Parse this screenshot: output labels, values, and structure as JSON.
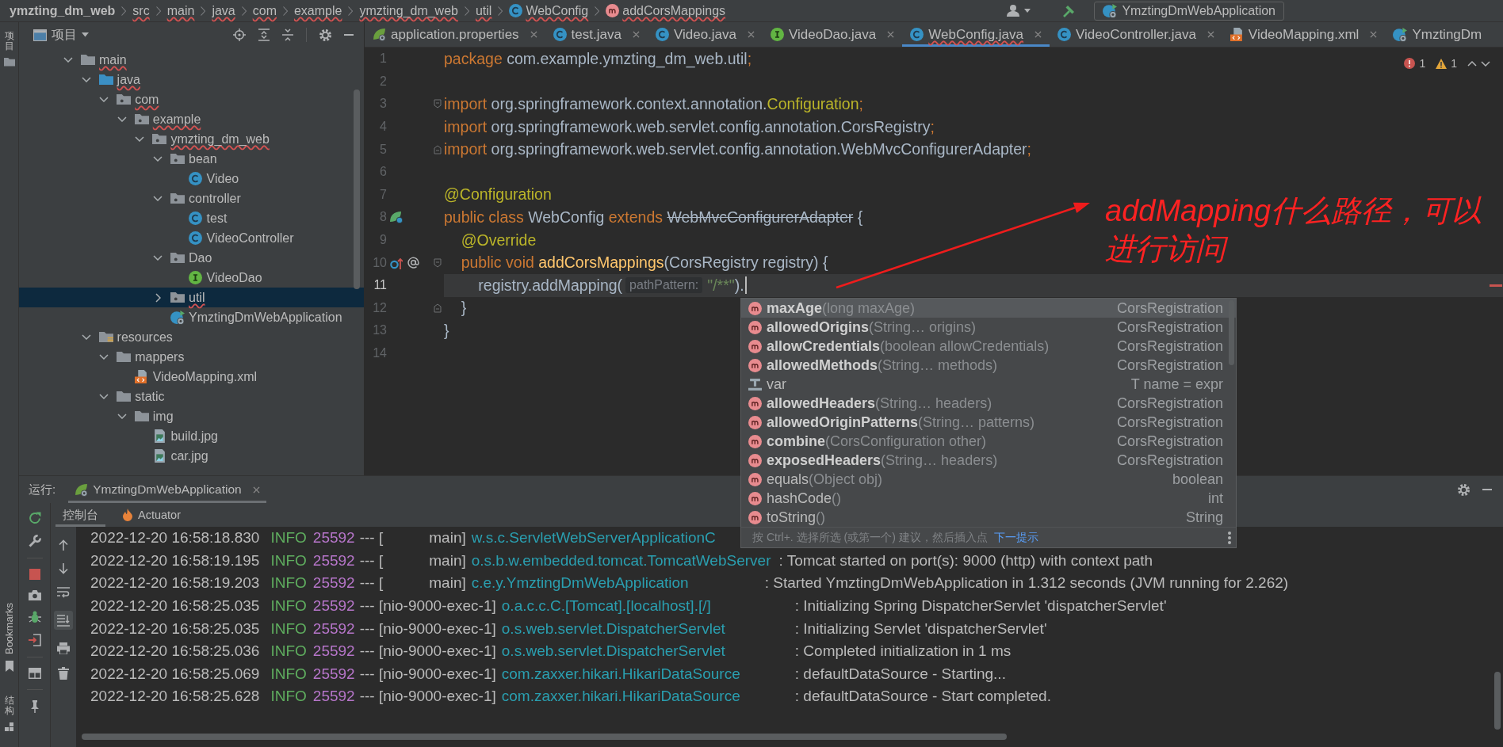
{
  "breadcrumbs": [
    {
      "text": "ymzting_dm_web",
      "kind": "project",
      "misspelled": false
    },
    {
      "text": "src",
      "kind": "folder",
      "misspelled": true
    },
    {
      "text": "main",
      "kind": "folder",
      "misspelled": true
    },
    {
      "text": "java",
      "kind": "folder",
      "misspelled": true
    },
    {
      "text": "com",
      "kind": "folder",
      "misspelled": true
    },
    {
      "text": "example",
      "kind": "folder",
      "misspelled": true
    },
    {
      "text": "ymzting_dm_web",
      "kind": "folder",
      "misspelled": true
    },
    {
      "text": "util",
      "kind": "folder",
      "misspelled": true
    },
    {
      "text": "WebConfig",
      "kind": "class",
      "misspelled": true
    },
    {
      "text": "addCorsMappings",
      "kind": "method",
      "misspelled": true
    }
  ],
  "run_config": {
    "label": "YmztingDmWebApplication"
  },
  "tool_strip": {
    "top": [
      {
        "label": "项目",
        "kind": "project"
      }
    ],
    "bottom": [
      {
        "label": "Bookmarks",
        "kind": "bookmarks"
      },
      {
        "label": "结构",
        "kind": "structure"
      }
    ]
  },
  "project_panel": {
    "title": "项目",
    "tree": [
      {
        "label": "main",
        "kind": "folder",
        "expanded": true,
        "selected": false,
        "misspelled": true,
        "children": [
          {
            "label": "java",
            "kind": "source-root",
            "expanded": true,
            "selected": false,
            "misspelled": true,
            "children": [
              {
                "label": "com",
                "kind": "package",
                "expanded": true,
                "selected": false,
                "misspelled": true,
                "children": [
                  {
                    "label": "example",
                    "kind": "package",
                    "expanded": true,
                    "selected": false,
                    "misspelled": true,
                    "children": [
                      {
                        "label": "ymzting_dm_web",
                        "kind": "package",
                        "expanded": true,
                        "selected": false,
                        "misspelled": true,
                        "children": [
                          {
                            "label": "bean",
                            "kind": "package",
                            "expanded": true,
                            "selected": false,
                            "misspelled": false,
                            "children": [
                              {
                                "label": "Video",
                                "kind": "class",
                                "selected": false,
                                "misspelled": false
                              }
                            ]
                          },
                          {
                            "label": "controller",
                            "kind": "package",
                            "expanded": true,
                            "selected": false,
                            "misspelled": false,
                            "children": [
                              {
                                "label": "test",
                                "kind": "class",
                                "selected": false,
                                "misspelled": false
                              },
                              {
                                "label": "VideoController",
                                "kind": "class",
                                "selected": false,
                                "misspelled": false
                              }
                            ]
                          },
                          {
                            "label": "Dao",
                            "kind": "package",
                            "expanded": true,
                            "selected": false,
                            "misspelled": false,
                            "children": [
                              {
                                "label": "VideoDao",
                                "kind": "interface",
                                "selected": false,
                                "misspelled": false
                              }
                            ]
                          },
                          {
                            "label": "util",
                            "kind": "package",
                            "expanded": false,
                            "selected": true,
                            "misspelled": true
                          },
                          {
                            "label": "YmztingDmWebApplication",
                            "kind": "spring-app",
                            "selected": false,
                            "misspelled": false
                          }
                        ]
                      }
                    ]
                  }
                ]
              }
            ]
          },
          {
            "label": "resources",
            "kind": "resources-root",
            "expanded": true,
            "selected": false,
            "misspelled": false,
            "children": [
              {
                "label": "mappers",
                "kind": "folder",
                "expanded": true,
                "selected": false,
                "misspelled": false,
                "children": [
                  {
                    "label": "VideoMapping.xml",
                    "kind": "xml",
                    "selected": false,
                    "misspelled": false
                  }
                ]
              },
              {
                "label": "static",
                "kind": "folder",
                "expanded": true,
                "selected": false,
                "misspelled": false,
                "children": [
                  {
                    "label": "img",
                    "kind": "folder",
                    "expanded": true,
                    "selected": false,
                    "misspelled": false,
                    "children": [
                      {
                        "label": "build.jpg",
                        "kind": "image",
                        "selected": false,
                        "misspelled": false
                      },
                      {
                        "label": "car.jpg",
                        "kind": "image",
                        "selected": false,
                        "misspelled": false
                      }
                    ]
                  }
                ]
              }
            ]
          }
        ]
      }
    ]
  },
  "editor_tabs": [
    {
      "label": "application.properties",
      "kind": "properties",
      "selected": false,
      "misspelled": false,
      "closable": true
    },
    {
      "label": "test.java",
      "kind": "class",
      "selected": false,
      "misspelled": false,
      "closable": true
    },
    {
      "label": "Video.java",
      "kind": "class",
      "selected": false,
      "misspelled": false,
      "closable": true
    },
    {
      "label": "VideoDao.java",
      "kind": "interface",
      "selected": false,
      "misspelled": false,
      "closable": true
    },
    {
      "label": "WebConfig.java",
      "kind": "class",
      "selected": true,
      "misspelled": true,
      "closable": true
    },
    {
      "label": "VideoController.java",
      "kind": "class",
      "selected": false,
      "misspelled": false,
      "closable": true
    },
    {
      "label": "VideoMapping.xml",
      "kind": "xml",
      "selected": false,
      "misspelled": false,
      "closable": true
    },
    {
      "label": "YmztingDm",
      "kind": "spring-app",
      "selected": false,
      "misspelled": false,
      "closable": false
    }
  ],
  "editor": {
    "inspections": {
      "errors": "1",
      "warnings": "1"
    },
    "lines": [
      {
        "number": "1",
        "current": false,
        "caret": false,
        "fold_start": false,
        "fold_end": false,
        "tokens": [
          {
            "text": "package",
            "kind": "keyword"
          },
          {
            "text": " com.example.ymzting_dm_web.util",
            "kind": "plain"
          },
          {
            "text": ";",
            "kind": "punct"
          }
        ]
      },
      {
        "number": "2",
        "current": false,
        "caret": false,
        "fold_start": false,
        "fold_end": false
      },
      {
        "number": "3",
        "current": false,
        "caret": false,
        "fold_start": true,
        "fold_end": false,
        "tokens": [
          {
            "text": "import",
            "kind": "keyword"
          },
          {
            "text": " org.springframework.context.annotation.",
            "kind": "plain"
          },
          {
            "text": "Configuration",
            "kind": "annotation"
          },
          {
            "text": ";",
            "kind": "punct"
          }
        ]
      },
      {
        "number": "4",
        "current": false,
        "caret": false,
        "fold_start": false,
        "fold_end": false,
        "tokens": [
          {
            "text": "import",
            "kind": "keyword"
          },
          {
            "text": " org.springframework.web.servlet.config.annotation.CorsRegistry",
            "kind": "plain"
          },
          {
            "text": ";",
            "kind": "punct"
          }
        ]
      },
      {
        "number": "5",
        "current": false,
        "caret": false,
        "fold_start": false,
        "fold_end": true,
        "tokens": [
          {
            "text": "import",
            "kind": "keyword"
          },
          {
            "text": " org.springframework.web.servlet.config.annotation.WebMvcConfigurerAdapter",
            "kind": "plain"
          },
          {
            "text": ";",
            "kind": "punct"
          }
        ]
      },
      {
        "number": "6",
        "current": false,
        "caret": false,
        "fold_start": false,
        "fold_end": false
      },
      {
        "number": "7",
        "current": false,
        "caret": false,
        "fold_start": false,
        "fold_end": false,
        "tokens": [
          {
            "text": "@Configuration",
            "kind": "annotation"
          }
        ]
      },
      {
        "number": "8",
        "current": false,
        "caret": false,
        "fold_start": false,
        "fold_end": false,
        "markers": [
          {
            "kind": "spring-bean"
          }
        ],
        "tokens": [
          {
            "text": "public class",
            "kind": "keyword"
          },
          {
            "text": " WebConfig ",
            "kind": "plain"
          },
          {
            "text": "extends ",
            "kind": "keyword"
          },
          {
            "text": "WebMvcConfigurerAdapter",
            "kind": "deprecated"
          },
          {
            "text": " {",
            "kind": "plain"
          }
        ]
      },
      {
        "number": "9",
        "current": false,
        "caret": false,
        "fold_start": false,
        "fold_end": false,
        "tokens": [
          {
            "text": "    @Override",
            "kind": "annotation"
          }
        ]
      },
      {
        "number": "10",
        "current": false,
        "caret": false,
        "fold_start": true,
        "fold_end": false,
        "markers": [
          {
            "kind": "override"
          },
          {
            "kind": "annotation"
          }
        ],
        "tokens": [
          {
            "text": "    public void ",
            "kind": "keyword"
          },
          {
            "text": "addCorsMappings",
            "kind": "method"
          },
          {
            "text": "(CorsRegistry registry) {",
            "kind": "plain"
          }
        ]
      },
      {
        "number": "11",
        "current": true,
        "caret": true,
        "fold_start": false,
        "fold_end": false,
        "tokens": [
          {
            "text": "        registry.addMapping(",
            "kind": "plain"
          },
          {
            "text": "pathPattern:",
            "kind": "hint"
          },
          {
            "text": "\"/**\"",
            "kind": "string"
          },
          {
            "text": ").",
            "kind": "plain"
          }
        ]
      },
      {
        "number": "12",
        "current": false,
        "caret": false,
        "fold_start": false,
        "fold_end": true,
        "tokens": [
          {
            "text": "    }",
            "kind": "plain"
          }
        ]
      },
      {
        "number": "13",
        "current": false,
        "caret": false,
        "fold_start": false,
        "fold_end": false,
        "tokens": [
          {
            "text": "}",
            "kind": "plain"
          }
        ]
      },
      {
        "number": "14",
        "current": false,
        "caret": false,
        "fold_start": false,
        "fold_end": false
      }
    ]
  },
  "annotation": {
    "lines": [
      "addMapping什么路径，可以",
      "进行访问"
    ]
  },
  "completion": {
    "items": [
      {
        "name": "maxAge",
        "params": "(long maxAge)",
        "type": "CorsRegistration",
        "kind": "method",
        "emphasized": true,
        "selected": true
      },
      {
        "name": "allowedOrigins",
        "params": "(String… origins)",
        "type": "CorsRegistration",
        "kind": "method",
        "emphasized": true,
        "selected": false
      },
      {
        "name": "allowCredentials",
        "params": "(boolean allowCredentials)",
        "type": "CorsRegistration",
        "kind": "method",
        "emphasized": true,
        "selected": false
      },
      {
        "name": "allowedMethods",
        "params": "(String… methods)",
        "type": "CorsRegistration",
        "kind": "method",
        "emphasized": true,
        "selected": false
      },
      {
        "name": "var",
        "type": "T name = expr",
        "kind": "template",
        "emphasized": false,
        "selected": false
      },
      {
        "name": "allowedHeaders",
        "params": "(String… headers)",
        "type": "CorsRegistration",
        "kind": "method",
        "emphasized": true,
        "selected": false
      },
      {
        "name": "allowedOriginPatterns",
        "params": "(String… patterns)",
        "type": "CorsRegistration",
        "kind": "method",
        "emphasized": true,
        "selected": false
      },
      {
        "name": "combine",
        "params": "(CorsConfiguration other)",
        "type": "CorsRegistration",
        "kind": "method",
        "emphasized": true,
        "selected": false
      },
      {
        "name": "exposedHeaders",
        "params": "(String… headers)",
        "type": "CorsRegistration",
        "kind": "method",
        "emphasized": true,
        "selected": false
      },
      {
        "name": "equals",
        "params": "(Object obj)",
        "type": "boolean",
        "kind": "method",
        "emphasized": false,
        "selected": false
      },
      {
        "name": "hashCode",
        "params": "()",
        "type": "int",
        "kind": "method",
        "emphasized": false,
        "selected": false
      },
      {
        "name": "toString",
        "params": "()",
        "type": "String",
        "kind": "method",
        "emphasized": false,
        "selected": false
      }
    ],
    "hint": "按 Ctrl+. 选择所选 (或第一个) 建议，然后插入点",
    "hint_link": "下一提示"
  },
  "run_panel": {
    "label": "运行:",
    "tab": {
      "label": "YmztingDmWebApplication",
      "selected": true
    },
    "subtabs": [
      {
        "label": "控制台",
        "kind": "console",
        "selected": true
      },
      {
        "label": "Actuator",
        "kind": "actuator",
        "selected": false
      }
    ],
    "scroll_to_end": true,
    "log": [
      {
        "timestamp": "2022-12-20 16:58:18.830",
        "level": "INFO",
        "pid": "25592",
        "thread": "--- [           main]",
        "logger": "w.s.c.ServletWebServerApplicationC"
      },
      {
        "timestamp": "2022-12-20 16:58:19.195",
        "level": "INFO",
        "pid": "25592",
        "thread": "--- [           main]",
        "logger": "o.s.b.w.embedded.tomcat.TomcatWebServer",
        "message": ": Tomcat started on port(s): 9000 (http) with context path"
      },
      {
        "timestamp": "2022-12-20 16:58:19.203",
        "level": "INFO",
        "pid": "25592",
        "thread": "--- [           main]",
        "logger": "c.e.y.YmztingDmWebApplication",
        "message": ": Started YmztingDmWebApplication in 1.312 seconds (JVM running for 2.262)"
      },
      {
        "timestamp": "2022-12-20 16:58:25.035",
        "level": "INFO",
        "pid": "25592",
        "thread": "--- [nio-9000-exec-1]",
        "logger": "o.a.c.c.C.[Tomcat].[localhost].[/]",
        "message": ": Initializing Spring DispatcherServlet 'dispatcherServlet'"
      },
      {
        "timestamp": "2022-12-20 16:58:25.035",
        "level": "INFO",
        "pid": "25592",
        "thread": "--- [nio-9000-exec-1]",
        "logger": "o.s.web.servlet.DispatcherServlet",
        "message": ": Initializing Servlet 'dispatcherServlet'"
      },
      {
        "timestamp": "2022-12-20 16:58:25.036",
        "level": "INFO",
        "pid": "25592",
        "thread": "--- [nio-9000-exec-1]",
        "logger": "o.s.web.servlet.DispatcherServlet",
        "message": ": Completed initialization in 1 ms"
      },
      {
        "timestamp": "2022-12-20 16:58:25.069",
        "level": "INFO",
        "pid": "25592",
        "thread": "--- [nio-9000-exec-1]",
        "logger": "com.zaxxer.hikari.HikariDataSource",
        "message": ": defaultDataSource - Starting..."
      },
      {
        "timestamp": "2022-12-20 16:58:25.628",
        "level": "INFO",
        "pid": "25592",
        "thread": "--- [nio-9000-exec-1]",
        "logger": "com.zaxxer.hikari.HikariDataSource",
        "message": ": defaultDataSource - Start completed."
      }
    ]
  }
}
